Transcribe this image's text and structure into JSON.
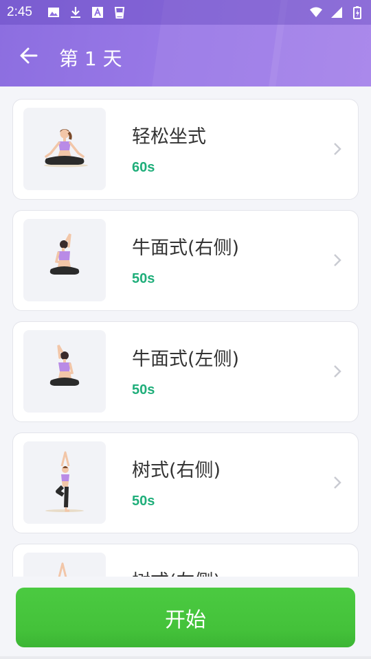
{
  "status_bar": {
    "time": "2:45"
  },
  "header": {
    "title": "第 1 天"
  },
  "exercises": [
    {
      "name": "轻松坐式",
      "duration": "60s"
    },
    {
      "name": "牛面式(右侧)",
      "duration": "50s"
    },
    {
      "name": "牛面式(左侧)",
      "duration": "50s"
    },
    {
      "name": "树式(右侧)",
      "duration": "50s"
    },
    {
      "name": "树式(左侧)",
      "duration": ""
    }
  ],
  "start_button": {
    "label": "开始"
  },
  "colors": {
    "header": "#9878e6",
    "duration": "#1fae7a",
    "start": "#46c33c"
  }
}
